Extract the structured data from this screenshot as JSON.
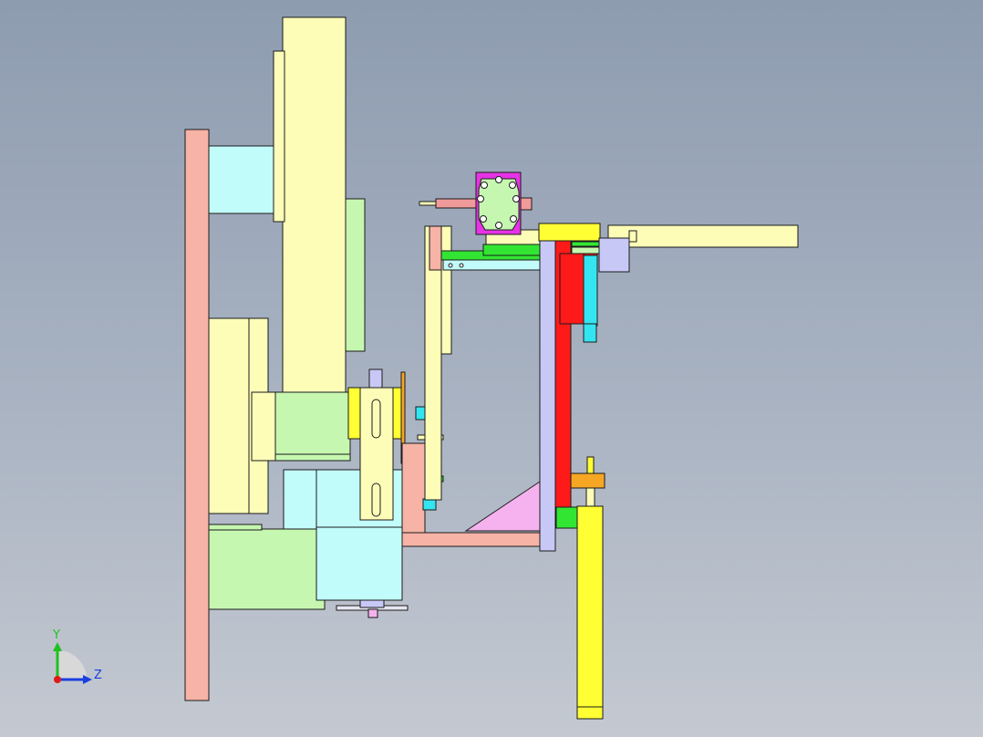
{
  "viewport": {
    "background_top": "#8e9cb0",
    "background_bottom": "#c4c9d1"
  },
  "model": {
    "parts": [
      {
        "name": "base-plate",
        "color": "#f6b3a6"
      },
      {
        "name": "upright-column",
        "color": "#fdfdb8"
      },
      {
        "name": "column-side-plate",
        "color": "#fdfdb8"
      },
      {
        "name": "cyan-spacer-block",
        "color": "#c1fbfa"
      },
      {
        "name": "green-rib-plate",
        "color": "#c6f7b0"
      },
      {
        "name": "cylinder-block",
        "color": "#fdfdb8"
      },
      {
        "name": "green-mount-block",
        "color": "#c6f7b0"
      },
      {
        "name": "lower-green-block",
        "color": "#c6f7b0"
      },
      {
        "name": "motor-housing",
        "color": "#c1fbfa"
      },
      {
        "name": "slotted-yellow-plate",
        "color": "#fdfdb8"
      },
      {
        "name": "yellow-clamp",
        "color": "#ffff33"
      },
      {
        "name": "pink-arm-beam",
        "color": "#f6b3a6"
      },
      {
        "name": "pink-gusset",
        "color": "#f5b2ee"
      },
      {
        "name": "lavender-vertical-post",
        "color": "#c8c8f7"
      },
      {
        "name": "red-slide-rail",
        "color": "#ff1a1a"
      },
      {
        "name": "yellow-top-cap",
        "color": "#ffff33"
      },
      {
        "name": "horizontal-cylinder",
        "color": "#fdfdb8"
      },
      {
        "name": "lavender-cylinder-head",
        "color": "#c8c8f7"
      },
      {
        "name": "red-block",
        "color": "#ff1a1a"
      },
      {
        "name": "cyan-guide",
        "color": "#33e5f0"
      },
      {
        "name": "orange-bracket",
        "color": "#f5a623"
      },
      {
        "name": "vertical-yellow-cylinder",
        "color": "#ffff33"
      },
      {
        "name": "green-slide-base",
        "color": "#33e533"
      },
      {
        "name": "magenta-flange",
        "color": "#e633e6"
      },
      {
        "name": "pink-shaft",
        "color": "#f09a9a"
      }
    ]
  },
  "triad": {
    "y_label": "Y",
    "z_label": "Z",
    "y_color": "#1fc21f",
    "z_color": "#1a3fe0",
    "origin_color": "#e01a1a"
  }
}
